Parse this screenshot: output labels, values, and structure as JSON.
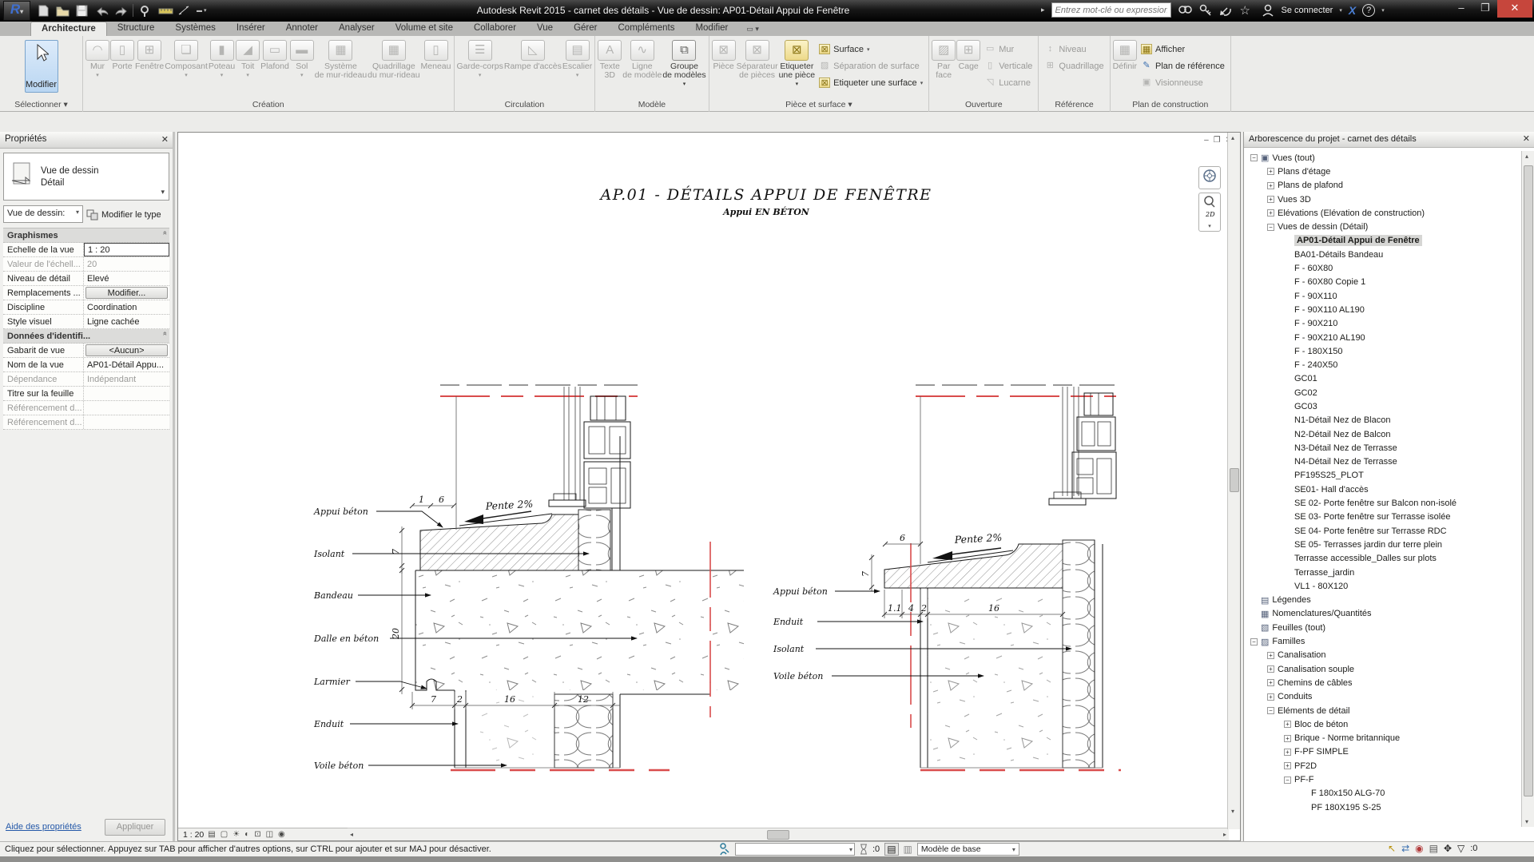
{
  "titlebar": {
    "title": "Autodesk Revit 2015 -   carnet des détails - Vue de dessin: AP01-Détail Appui de Fenêtre",
    "search_placeholder": "Entrez mot-clé ou expression",
    "signin_label": "Se connecter",
    "exchange_label": "X",
    "help_label": "?"
  },
  "tabs": {
    "items": [
      "Architecture",
      "Structure",
      "Systèmes",
      "Insérer",
      "Annoter",
      "Analyser",
      "Volume et site",
      "Collaborer",
      "Vue",
      "Gérer",
      "Compléments",
      "Modifier"
    ],
    "active": "Architecture"
  },
  "ribbon": {
    "modify_label": "Modifier",
    "select_label": "Sélectionner ▾",
    "panels": [
      {
        "label": "Création",
        "big": [
          {
            "label": "Mur",
            "icon": "wall",
            "arrow": true
          },
          {
            "label": "Porte",
            "icon": "door"
          },
          {
            "label": "Fenêtre",
            "icon": "window"
          },
          {
            "label": "Composant",
            "icon": "component",
            "arrow": true
          },
          {
            "label": "Poteau",
            "icon": "column",
            "arrow": true
          },
          {
            "label": "Toit",
            "icon": "roof",
            "arrow": true
          },
          {
            "label": "Plafond",
            "icon": "ceiling"
          },
          {
            "label": "Sol",
            "icon": "floor",
            "arrow": true
          },
          {
            "label": "Système\nde mur-rideau",
            "icon": "curtain-system"
          },
          {
            "label": "Quadrillage\ndu mur-rideau",
            "icon": "curtain-grid"
          },
          {
            "label": "Meneau",
            "icon": "mullion"
          }
        ]
      },
      {
        "label": "Circulation",
        "big": [
          {
            "label": "Garde-corps",
            "icon": "railing",
            "arrow": true
          },
          {
            "label": "Rampe d'accès",
            "icon": "ramp"
          },
          {
            "label": "Escalier",
            "icon": "stair",
            "arrow": true
          }
        ]
      },
      {
        "label": "Modèle",
        "big": [
          {
            "label": "Texte\n3D",
            "icon": "model-text"
          },
          {
            "label": "Ligne\nde modèle",
            "icon": "model-line"
          },
          {
            "label": "Groupe\nde modèles",
            "icon": "model-group",
            "arrow": true,
            "enabled": true
          }
        ]
      },
      {
        "label": "Pièce et surface ▾",
        "big": [
          {
            "label": "Pièce",
            "icon": "room"
          },
          {
            "label": "Séparateur\nde pièces",
            "icon": "room-separator"
          },
          {
            "label": "Etiqueter\nune pièce",
            "icon": "tag-room",
            "arrow": true,
            "enabled": true
          }
        ],
        "stack": [
          {
            "label": "Surface",
            "icon": "area",
            "arrow": true,
            "enabled": true
          },
          {
            "label": "Séparation  de surface",
            "icon": "area-separator"
          },
          {
            "label": "Etiqueter  une surface",
            "icon": "tag-area",
            "arrow": true,
            "enabled": true
          }
        ]
      },
      {
        "label": "Ouverture",
        "big": [
          {
            "label": "Par\nface",
            "icon": "opening-by-face"
          },
          {
            "label": "Cage",
            "icon": "shaft"
          }
        ],
        "stack": [
          {
            "label": "Mur",
            "icon": "wall-opening"
          },
          {
            "label": "Verticale",
            "icon": "vertical-opening"
          },
          {
            "label": "Lucarne",
            "icon": "dormer"
          }
        ]
      },
      {
        "label": "Référence",
        "stack": [
          {
            "label": "Niveau",
            "icon": "level"
          },
          {
            "label": "Quadrillage",
            "icon": "grid"
          }
        ]
      },
      {
        "label": "Plan de construction",
        "big": [
          {
            "label": "Définir",
            "icon": "set-workplane"
          }
        ],
        "stack": [
          {
            "label": "Afficher",
            "icon": "show-workplane",
            "enabled": true
          },
          {
            "label": "Plan de référence",
            "icon": "ref-plane",
            "enabled": true
          },
          {
            "label": "Visionneuse",
            "icon": "viewer"
          }
        ]
      }
    ]
  },
  "properties": {
    "header": "Propriétés",
    "type_line1": "Vue de dessin",
    "type_line2": "Détail",
    "filter_label": "Vue de dessin:",
    "edit_type_label": "Modifier le type",
    "rows": [
      {
        "type": "section",
        "label": "Graphismes"
      },
      {
        "label": "Echelle de la vue",
        "value": "1 : 20",
        "style": "input"
      },
      {
        "label": "Valeur de l'échell...",
        "value": "20",
        "gray": true
      },
      {
        "label": "Niveau de détail",
        "value": "Elevé"
      },
      {
        "label": "Remplacements ...",
        "value": "Modifier...",
        "style": "button"
      },
      {
        "label": "Discipline",
        "value": "Coordination"
      },
      {
        "label": "Style visuel",
        "value": "Ligne cachée"
      },
      {
        "type": "section",
        "label": "Données d'identifi..."
      },
      {
        "label": "Gabarit de vue",
        "value": "<Aucun>",
        "style": "button"
      },
      {
        "label": "Nom de la vue",
        "value": "AP01-Détail Appu..."
      },
      {
        "label": "Dépendance",
        "value": "Indépendant",
        "gray": true
      },
      {
        "label": "Titre sur la feuille",
        "value": ""
      },
      {
        "label": "Référencement d...",
        "value": "",
        "gray": true
      },
      {
        "label": "Référencement d...",
        "value": "",
        "gray": true
      }
    ],
    "help_link": "Aide des propriétés",
    "apply_label": "Appliquer"
  },
  "drawing": {
    "title": "AP.01 - DÉTAILS APPUI DE FENÊTRE",
    "subtitle": "Appui EN BÉTON",
    "left": {
      "labels": [
        "Appui béton",
        "Isolant",
        "Bandeau",
        "Dalle en béton",
        "Larmier",
        "Enduit",
        "Voile béton"
      ],
      "pente": "Pente 2%",
      "dims_top": [
        "1",
        "6"
      ],
      "dim_height": "7",
      "dim_slab": "20",
      "dims_bottom": [
        "7",
        "2",
        "16",
        "12"
      ]
    },
    "right": {
      "labels": [
        "Appui béton",
        "Enduit",
        "Isolant",
        "Voile béton"
      ],
      "pente": "Pente 2%",
      "dim_top": "6",
      "dim_height": "7",
      "dims_bottom": [
        "1.1",
        "4",
        "2",
        "16"
      ]
    }
  },
  "viewbar": {
    "scale": "1 : 20"
  },
  "browser": {
    "title": "Arborescence du projet - carnet des détails",
    "items": [
      {
        "label": "Vues (tout)",
        "level": 0,
        "expander": "minus",
        "icon": "views"
      },
      {
        "label": "Plans d'étage",
        "level": 1,
        "expander": "plus"
      },
      {
        "label": "Plans de plafond",
        "level": 1,
        "expander": "plus"
      },
      {
        "label": "Vues 3D",
        "level": 1,
        "expander": "plus"
      },
      {
        "label": "Elévations (Elévation de construction)",
        "level": 1,
        "expander": "plus"
      },
      {
        "label": "Vues de dessin (Détail)",
        "level": 1,
        "expander": "minus"
      },
      {
        "label": "AP01-Détail Appui de Fenêtre",
        "level": 2,
        "selected": true
      },
      {
        "label": "BA01-Détails Bandeau",
        "level": 2
      },
      {
        "label": "F - 60X80",
        "level": 2
      },
      {
        "label": "F - 60X80 Copie 1",
        "level": 2
      },
      {
        "label": "F - 90X110",
        "level": 2
      },
      {
        "label": "F - 90X110 AL190",
        "level": 2
      },
      {
        "label": "F - 90X210",
        "level": 2
      },
      {
        "label": "F - 90X210 AL190",
        "level": 2
      },
      {
        "label": "F - 180X150",
        "level": 2
      },
      {
        "label": "F - 240X50",
        "level": 2
      },
      {
        "label": "GC01",
        "level": 2
      },
      {
        "label": "GC02",
        "level": 2
      },
      {
        "label": "GC03",
        "level": 2
      },
      {
        "label": "N1-Détail Nez de Blacon",
        "level": 2
      },
      {
        "label": "N2-Détail Nez de Balcon",
        "level": 2
      },
      {
        "label": "N3-Détail Nez de Terrasse",
        "level": 2
      },
      {
        "label": "N4-Détail Nez de Terrasse",
        "level": 2
      },
      {
        "label": "PF195S25_PLOT",
        "level": 2
      },
      {
        "label": "SE01- Hall d'accès",
        "level": 2
      },
      {
        "label": "SE 02- Porte fenêtre sur Balcon non-isolé",
        "level": 2
      },
      {
        "label": "SE 03- Porte fenêtre sur Terrasse isolée",
        "level": 2
      },
      {
        "label": "SE 04- Porte fenêtre sur Terrasse RDC",
        "level": 2
      },
      {
        "label": "SE 05- Terrasses jardin dur terre plein",
        "level": 2
      },
      {
        "label": "Terrasse accessible_Dalles sur plots",
        "level": 2
      },
      {
        "label": "Terrasse_jardin",
        "level": 2
      },
      {
        "label": "VL1 - 80X120",
        "level": 2
      },
      {
        "label": "Légendes",
        "level": 0,
        "icon": "legends"
      },
      {
        "label": "Nomenclatures/Quantités",
        "level": 0,
        "icon": "schedules"
      },
      {
        "label": "Feuilles (tout)",
        "level": 0,
        "icon": "sheets"
      },
      {
        "label": "Familles",
        "level": 0,
        "expander": "minus",
        "icon": "families"
      },
      {
        "label": "Canalisation",
        "level": 1,
        "expander": "plus"
      },
      {
        "label": "Canalisation souple",
        "level": 1,
        "expander": "plus"
      },
      {
        "label": "Chemins de câbles",
        "level": 1,
        "expander": "plus"
      },
      {
        "label": "Conduits",
        "level": 1,
        "expander": "plus"
      },
      {
        "label": "Eléments de détail",
        "level": 1,
        "expander": "minus"
      },
      {
        "label": "Bloc de béton",
        "level": 2,
        "expander": "plus"
      },
      {
        "label": "Brique - Norme britannique",
        "level": 2,
        "expander": "plus"
      },
      {
        "label": "F-PF SIMPLE",
        "level": 2,
        "expander": "plus"
      },
      {
        "label": "PF2D",
        "level": 2,
        "expander": "plus"
      },
      {
        "label": "PF-F",
        "level": 2,
        "expander": "minus"
      },
      {
        "label": "F 180x150 ALG-70",
        "level": 3
      },
      {
        "label": "PF 180X195 S-25",
        "level": 3
      }
    ]
  },
  "statusbar": {
    "hint": "Cliquez pour sélectionner. Appuyez sur TAB pour afficher d'autres options, sur CTRL pour ajouter et sur MAJ pour désactiver.",
    "exclude_count": ":0",
    "base_model": "Modèle de base",
    "filter_count": ":0"
  },
  "colors": {
    "accent_blue": "#b9d6f2",
    "red_line": "#d94c4c",
    "close_red": "#c6463c"
  }
}
